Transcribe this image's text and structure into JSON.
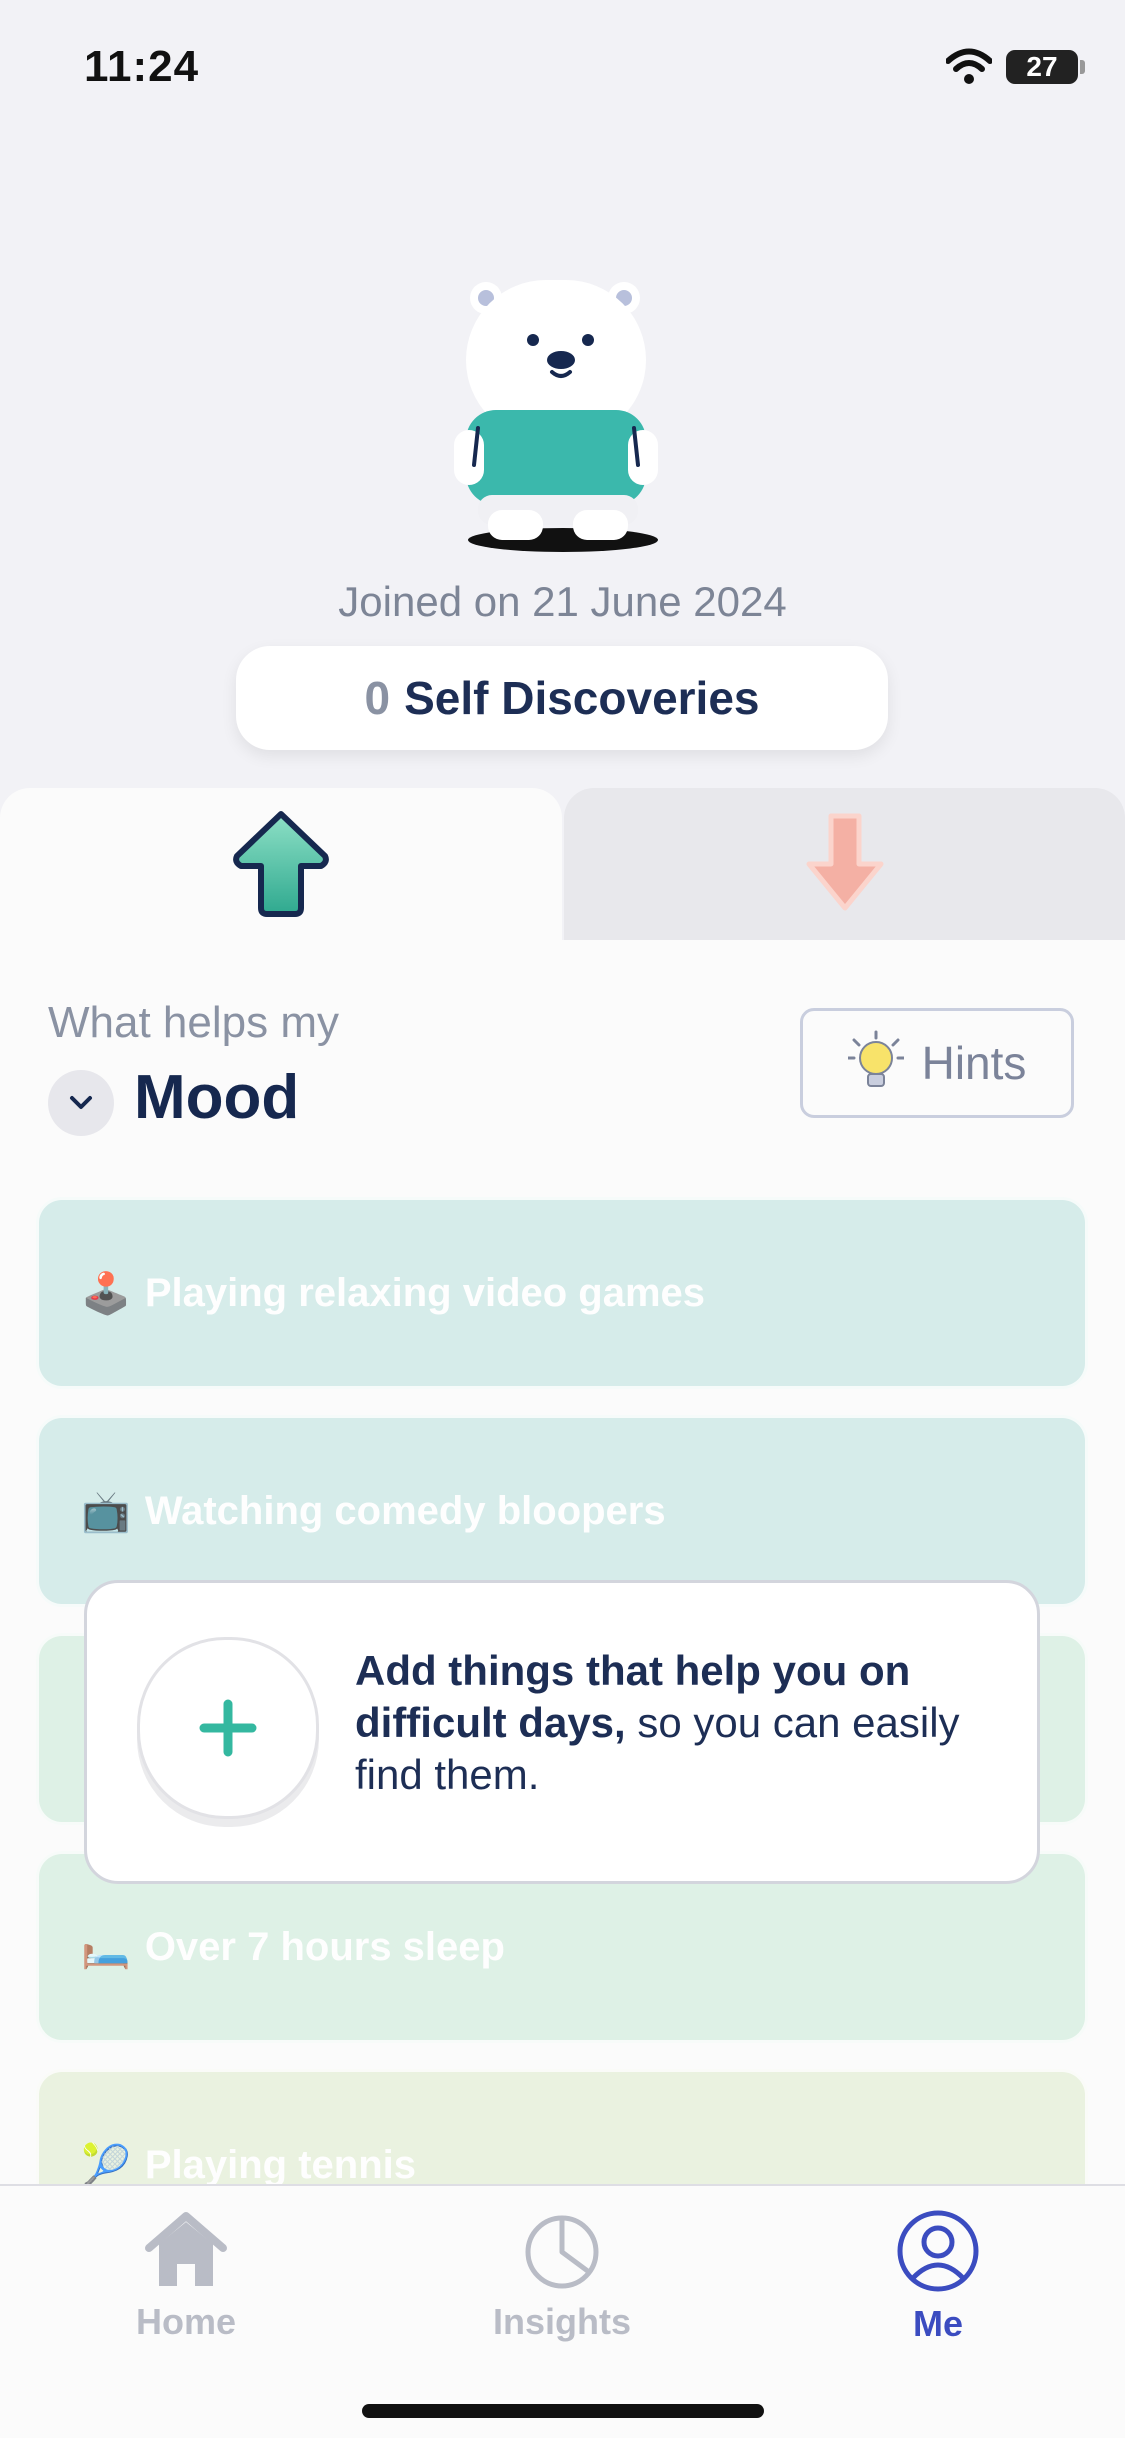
{
  "status_bar": {
    "time": "11:24",
    "battery": "27"
  },
  "profile": {
    "joined_text": "Joined on 21 June 2024",
    "discoveries_count": "0",
    "discoveries_label": "Self Discoveries"
  },
  "tabs": [
    {
      "label": "up-arrow-icon",
      "selected": true
    },
    {
      "label": "down-arrow-icon",
      "selected": false
    }
  ],
  "section": {
    "prefix": "What helps my",
    "category": "Mood",
    "hints_label": "Hints"
  },
  "items": [
    {
      "emoji": "🕹️",
      "label": "Playing relaxing video games",
      "color": "#cde9e7"
    },
    {
      "emoji": "📺",
      "label": "Watching comedy bloopers",
      "color": "#cde9e7"
    },
    {
      "emoji": "",
      "label": "",
      "color": "#d8efe1"
    },
    {
      "emoji": "🛏️",
      "label": "Over 7 hours sleep",
      "color": "#d8efe1"
    },
    {
      "emoji": "🎾",
      "label": "Playing tennis",
      "color": "#e6f1da"
    }
  ],
  "overlay": {
    "bold_text": "Add things that help you on difficult days,",
    "rest_text": " so you can easily find them."
  },
  "bottom_nav": [
    {
      "label": "Home",
      "icon": "home-icon",
      "active": false
    },
    {
      "label": "Insights",
      "icon": "pie-chart-icon",
      "active": false
    },
    {
      "label": "Me",
      "icon": "profile-icon",
      "active": true
    }
  ],
  "colors": {
    "accent": "#3b4cc0",
    "teal": "#3bbfa8",
    "pink": "#f3a89c",
    "navy": "#1d2e55"
  }
}
